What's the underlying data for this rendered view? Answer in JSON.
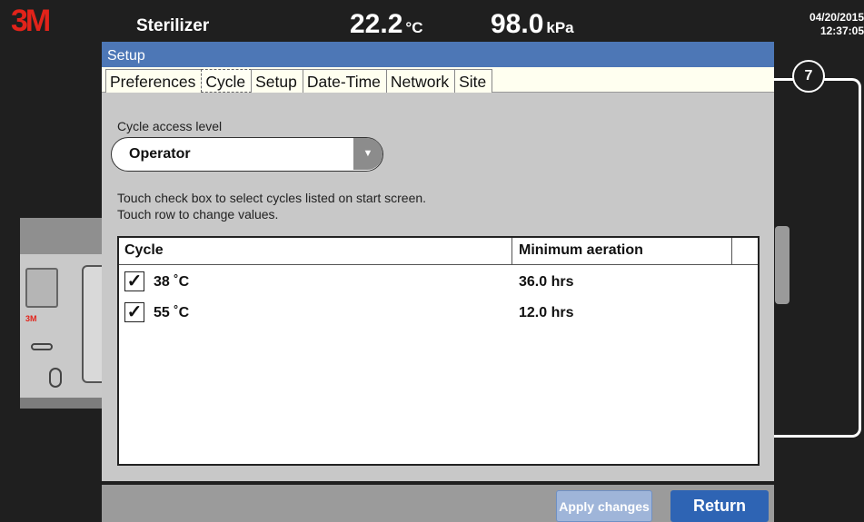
{
  "header": {
    "logo_text": "3M",
    "device_name": "Sterilizer",
    "temperature_value": "22.2",
    "temperature_unit": "°C",
    "pressure_value": "98.0",
    "pressure_unit": "kPa",
    "date": "04/20/2015",
    "time": "12:37:05"
  },
  "illustration": {
    "machine_brand": "3M"
  },
  "callout": {
    "number": "7"
  },
  "dialog": {
    "title": "Setup",
    "tabs": [
      {
        "label": "Preferences",
        "active": false
      },
      {
        "label": "Cycle",
        "active": true
      },
      {
        "label": "Setup",
        "active": false
      },
      {
        "label": "Date-Time",
        "active": false
      },
      {
        "label": "Network",
        "active": false
      },
      {
        "label": "Site",
        "active": false
      }
    ],
    "access_level_label": "Cycle access level",
    "access_level_value": "Operator",
    "instruction_line1": "Touch check box to select cycles listed on start screen.",
    "instruction_line2": "Touch row to change values.",
    "table": {
      "columns": [
        "Cycle",
        "Minimum aeration"
      ],
      "rows": [
        {
          "checked": true,
          "check_mark": "✓",
          "cycle": "38 ˚C",
          "aeration": "36.0 hrs"
        },
        {
          "checked": true,
          "check_mark": "✓",
          "cycle": "55 ˚C",
          "aeration": "12.0 hrs"
        }
      ]
    }
  },
  "buttons": {
    "apply_label": "Apply changes",
    "return_label": "Return"
  },
  "colors": {
    "title_bar": "#4d77b6",
    "return_button": "#2e64b4",
    "apply_button": "#9fb5d9",
    "logo": "#e2231a"
  }
}
